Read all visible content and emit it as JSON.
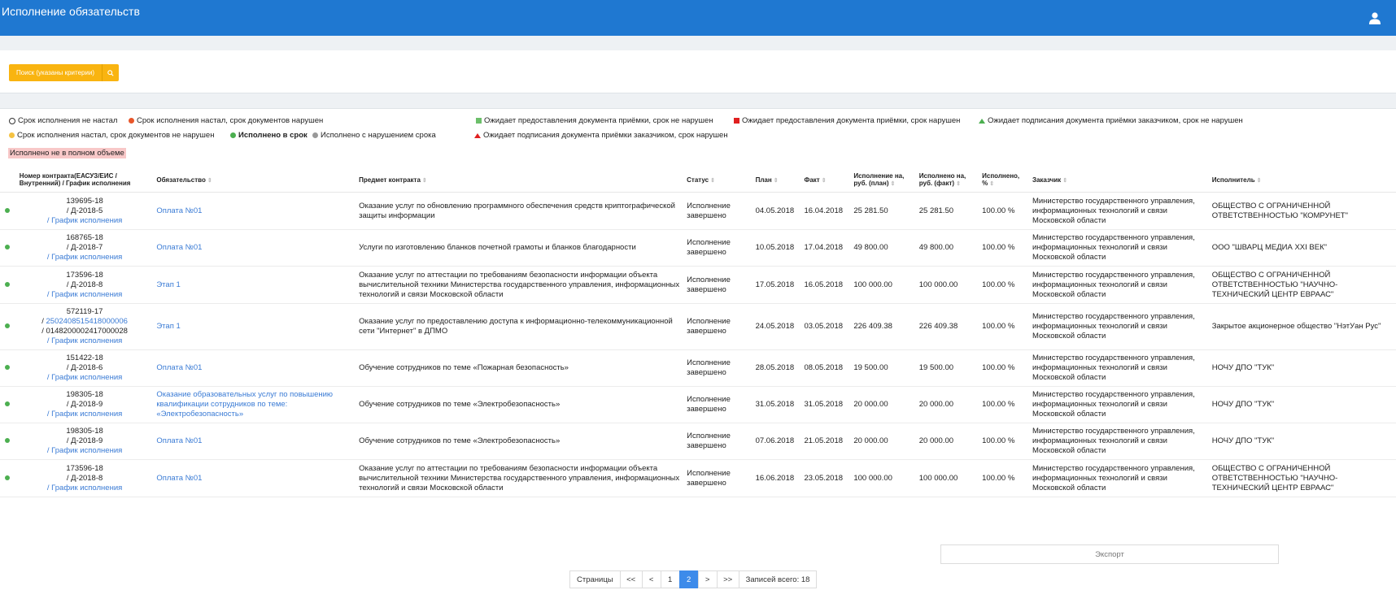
{
  "header": {
    "title": "Исполнение обязательств",
    "user_icon": "user-icon"
  },
  "search": {
    "label": "Поиск (указаны критерии)",
    "icon": "search-icon"
  },
  "legend": {
    "items": [
      {
        "label": "Срок исполнения не настал",
        "marker": "circle-outline",
        "color": "#ffffff"
      },
      {
        "label": "Срок исполнения настал, срок документов нарушен",
        "marker": "circle",
        "color": "#e8562a"
      },
      {
        "label": "Ожидает предоставления документа приёмки, срок не нарушен",
        "marker": "square",
        "color": "#6cbf6a"
      },
      {
        "label": "Ожидает предоставления документа приёмки, срок нарушен",
        "marker": "square",
        "color": "#e02020"
      },
      {
        "label": "Ожидает подписания документа приёмки заказчиком, срок не нарушен",
        "marker": "triangle",
        "color": "#4caf50"
      },
      {
        "label": "Срок исполнения настал, срок документов не нарушен",
        "marker": "circle",
        "color": "#f5c242"
      },
      {
        "label": "Исполнено в срок",
        "marker": "circle",
        "color": "#4caf50"
      },
      {
        "label": "Исполнено с нарушением срока",
        "marker": "circle",
        "color": "#999999"
      },
      {
        "label": "Ожидает подписания документа приёмки заказчиком, срок нарушен",
        "marker": "triangle",
        "color": "#e02020"
      }
    ],
    "partial": "Исполнено не в полном объеме"
  },
  "table": {
    "columns": [
      "Номер контракта(ЕАСУЗ/ЕИС /Внутренний) / График исполнения",
      "Обязательство",
      "Предмет контракта",
      "Статус",
      "План",
      "Факт",
      "Исполнение на, руб. (план)",
      "Исполнено на, руб. (факт)",
      "Исполнено, %",
      "Заказчик",
      "Исполнитель"
    ],
    "rows": [
      {
        "num": "139695-18",
        "eis": "",
        "internal": "/ Д-2018-5",
        "schedule": "/ График исполнения",
        "obligation": "Оплата №01",
        "subject": "Оказание услуг по обновлению программного обеспечения средств криптографической защиты информации",
        "status": "Исполнение завершено",
        "plan": "04.05.2018",
        "fact": "16.04.2018",
        "sum_plan": "25 281.50",
        "sum_fact": "25 281.50",
        "pct": "100.00 %",
        "customer": "Министерство государственного управления, информационных технологий и связи Московской области",
        "executor": "ОБЩЕСТВО С ОГРАНИЧЕННОЙ ОТВЕТСТВЕННОСТЬЮ \"КОМРУНЕТ\""
      },
      {
        "num": "168765-18",
        "eis": "",
        "internal": "/ Д-2018-7",
        "schedule": "/ График исполнения",
        "obligation": "Оплата №01",
        "subject": "Услуги по изготовлению бланков почетной грамоты и бланков благодарности",
        "status": "Исполнение завершено",
        "plan": "10.05.2018",
        "fact": "17.04.2018",
        "sum_plan": "49 800.00",
        "sum_fact": "49 800.00",
        "pct": "100.00 %",
        "customer": "Министерство государственного управления, информационных технологий и связи Московской области",
        "executor": "ООО \"ШВАРЦ МЕДИА XXI ВЕК\""
      },
      {
        "num": "173596-18",
        "eis": "",
        "internal": "/ Д-2018-8",
        "schedule": "/ График исполнения",
        "obligation": "Этап 1",
        "subject": "Оказание услуг по аттестации по требованиям безопасности информации объекта вычислительной техники Министерства государственного управления, информационных технологий и связи Московской области",
        "status": "Исполнение завершено",
        "plan": "17.05.2018",
        "fact": "16.05.2018",
        "sum_plan": "100 000.00",
        "sum_fact": "100 000.00",
        "pct": "100.00 %",
        "customer": "Министерство государственного управления, информационных технологий и связи Московской области",
        "executor": "ОБЩЕСТВО С ОГРАНИЧЕННОЙ ОТВЕТСТВЕННОСТЬЮ \"НАУЧНО-ТЕХНИЧЕСКИЙ ЦЕНТР ЕВРААС\""
      },
      {
        "num": "572119-17",
        "eis": "2502408515418000006",
        "internal": "/ 0148200002417000028",
        "schedule": "/ График исполнения",
        "obligation": "Этап 1",
        "subject": "Оказание услуг по предоставлению доступа к информационно-телекоммуникационной сети \"Интернет\" в ДПМО",
        "status": "Исполнение завершено",
        "plan": "24.05.2018",
        "fact": "03.05.2018",
        "sum_plan": "226 409.38",
        "sum_fact": "226 409.38",
        "pct": "100.00 %",
        "customer": "Министерство государственного управления, информационных технологий и связи Московской области",
        "executor": "Закрытое акционерное общество \"НэтУан Рус\""
      },
      {
        "num": "151422-18",
        "eis": "",
        "internal": "/ Д-2018-6",
        "schedule": "/ График исполнения",
        "obligation": "Оплата №01",
        "subject": "Обучение сотрудников по теме «Пожарная безопасность»",
        "status": "Исполнение завершено",
        "plan": "28.05.2018",
        "fact": "08.05.2018",
        "sum_plan": "19 500.00",
        "sum_fact": "19 500.00",
        "pct": "100.00 %",
        "customer": "Министерство государственного управления, информационных технологий и связи Московской области",
        "executor": "НОЧУ ДПО \"ТУК\""
      },
      {
        "num": "198305-18",
        "eis": "",
        "internal": "/ Д-2018-9",
        "schedule": "/ График исполнения",
        "obligation": "Оказание образовательных услуг по повышению квалификации сотрудников по теме: «Электробезопасность»",
        "subject": "Обучение сотрудников по теме «Электробезопасность»",
        "status": "Исполнение завершено",
        "plan": "31.05.2018",
        "fact": "31.05.2018",
        "sum_plan": "20 000.00",
        "sum_fact": "20 000.00",
        "pct": "100.00 %",
        "customer": "Министерство государственного управления, информационных технологий и связи Московской области",
        "executor": "НОЧУ ДПО \"ТУК\""
      },
      {
        "num": "198305-18",
        "eis": "",
        "internal": "/ Д-2018-9",
        "schedule": "/ График исполнения",
        "obligation": "Оплата №01",
        "subject": "Обучение сотрудников по теме «Электробезопасность»",
        "status": "Исполнение завершено",
        "plan": "07.06.2018",
        "fact": "21.05.2018",
        "sum_plan": "20 000.00",
        "sum_fact": "20 000.00",
        "pct": "100.00 %",
        "customer": "Министерство государственного управления, информационных технологий и связи Московской области",
        "executor": "НОЧУ ДПО \"ТУК\""
      },
      {
        "num": "173596-18",
        "eis": "",
        "internal": "/ Д-2018-8",
        "schedule": "/ График исполнения",
        "obligation": "Оплата №01",
        "subject": "Оказание услуг по аттестации по требованиям безопасности информации объекта вычислительной техники Министерства государственного управления, информационных технологий и связи Московской области",
        "status": "Исполнение завершено",
        "plan": "16.06.2018",
        "fact": "23.05.2018",
        "sum_plan": "100 000.00",
        "sum_fact": "100 000.00",
        "pct": "100.00 %",
        "customer": "Министерство государственного управления, информационных технологий и связи Московской области",
        "executor": "ОБЩЕСТВО С ОГРАНИЧЕННОЙ ОТВЕТСТВЕННОСТЬЮ \"НАУЧНО-ТЕХНИЧЕСКИЙ ЦЕНТР ЕВРААС\""
      }
    ]
  },
  "export": {
    "label": "Экспорт"
  },
  "pagination": {
    "label": "Страницы",
    "first": "<<",
    "prev": "<",
    "pages": [
      "1",
      "2"
    ],
    "current": "2",
    "next": ">",
    "last": ">>",
    "total": "Записей всего: 18"
  }
}
